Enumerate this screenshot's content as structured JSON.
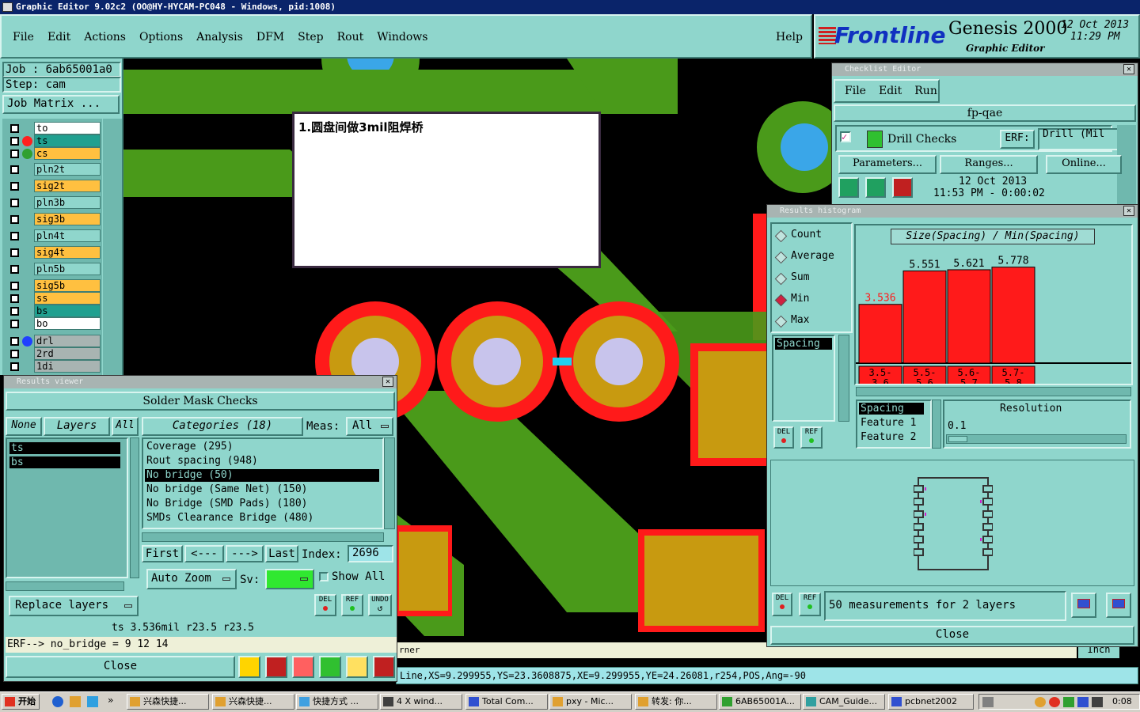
{
  "title_bar": {
    "text": "Graphic Editor 9.02c2  (OO@HY-HYCAM-PC048 - Windows, pid:1008)"
  },
  "menu": [
    "File",
    "Edit",
    "Actions",
    "Options",
    "Analysis",
    "DFM",
    "Step",
    "Rout",
    "Windows"
  ],
  "help_label": "Help",
  "brand": {
    "logo": "Frontline",
    "product": "Genesis 2000",
    "subtitle": "Graphic Editor",
    "date": "12 Oct 2013",
    "time": "11:29 PM"
  },
  "job_panel": {
    "job": "Job  :  6ab65001a0",
    "step": "Step:  cam",
    "matrix_button": "Job Matrix ..."
  },
  "layers": [
    {
      "name": "to",
      "color": "#ffffff",
      "dot": ""
    },
    {
      "name": "ts",
      "color": "#20a090",
      "dot": "#ff2020"
    },
    {
      "name": "cs",
      "color": "#ffc040",
      "dot": "#30a030"
    },
    {
      "name": "pln2t",
      "color": "#8fd6cc",
      "dot": ""
    },
    {
      "name": "sig2t",
      "color": "#ffc040",
      "dot": ""
    },
    {
      "name": "pln3b",
      "color": "#8fd6cc",
      "dot": ""
    },
    {
      "name": "sig3b",
      "color": "#ffc040",
      "dot": ""
    },
    {
      "name": "pln4t",
      "color": "#8fd6cc",
      "dot": ""
    },
    {
      "name": "sig4t",
      "color": "#ffc040",
      "dot": ""
    },
    {
      "name": "pln5b",
      "color": "#8fd6cc",
      "dot": ""
    },
    {
      "name": "sig5b",
      "color": "#ffc040",
      "dot": ""
    },
    {
      "name": "ss",
      "color": "#ffc040",
      "dot": ""
    },
    {
      "name": "bs",
      "color": "#20a090",
      "dot": ""
    },
    {
      "name": "bo",
      "color": "#ffffff",
      "dot": ""
    },
    {
      "name": "drl",
      "color": "#a8b4b2",
      "dot": "#2040ff"
    },
    {
      "name": "2rd",
      "color": "#a8b4b2",
      "dot": ""
    },
    {
      "name": "1di",
      "color": "#a8b4b2",
      "dot": ""
    }
  ],
  "note_popup": {
    "text": "1.圆盘间做3mil阻焊桥"
  },
  "results_viewer": {
    "title": "Results viewer",
    "header": "Solder Mask Checks",
    "none_btn": "None",
    "layers_btn": "Layers",
    "all_btn": "All",
    "layer_items": [
      "ts",
      "bs"
    ],
    "categories_label": "Categories (18)",
    "meas_label": "Meas:",
    "meas_value": "All",
    "categories": [
      "Coverage (295)",
      "Rout spacing (948)",
      "No bridge (50)",
      "No bridge (Same Net) (150)",
      "No Bridge (SMD Pads) (180)",
      "SMDs Clearance Bridge (480)"
    ],
    "selected_index": 2,
    "nav": {
      "first": "First",
      "prev": "<---",
      "next": "--->",
      "last": "Last",
      "index_label": "Index:",
      "index_value": "2696"
    },
    "auto_zoom": "Auto Zoom",
    "sv_label": "Sv:",
    "show_all": "Show All",
    "replace_layers": "Replace layers",
    "del": "DEL",
    "ref": "REF",
    "undo": "UNDO",
    "status1": "ts 3.536mil   r23.5   r23.5",
    "status2": "ERF--> no_bridge = 9 12 14",
    "close": "Close"
  },
  "checklist_editor": {
    "title": "Checklist Editor",
    "menu": [
      "File",
      "Edit",
      "Run"
    ],
    "name": "fp-qae",
    "check_name": "Drill Checks",
    "erf_label": "ERF:",
    "erf_value": "Drill (Mil",
    "buttons": [
      "Parameters...",
      "Ranges...",
      "Online..."
    ],
    "run_date": "12 Oct 2013",
    "run_time": "11:53 PM - 0:00:02"
  },
  "histogram": {
    "title": "Results histogram",
    "options": [
      {
        "label": "Count",
        "selected": false
      },
      {
        "label": "Average",
        "selected": false
      },
      {
        "label": "Sum",
        "selected": false
      },
      {
        "label": "Min",
        "selected": true
      },
      {
        "label": "Max",
        "selected": false
      }
    ],
    "list_items": [
      "Spacing"
    ],
    "chart_title": "Size(Spacing) / Min(Spacing)",
    "table_items": [
      "Spacing",
      "Feature 1",
      "Feature 2"
    ],
    "resolution_label": "Resolution",
    "resolution_value": "0.1",
    "measurements": "50 measurements for 2 layers",
    "del": "DEL",
    "ref": "REF",
    "close": "Close"
  },
  "chart_data": {
    "type": "bar",
    "title": "Size(Spacing) / Min(Spacing)",
    "categories": [
      "3.5-3.6",
      "5.5-5.6",
      "5.6-5.7",
      "5.7-5.8"
    ],
    "category_lines": [
      [
        "3.5-",
        "3.6"
      ],
      [
        "5.5-",
        "5.6"
      ],
      [
        "5.6-",
        "5.7"
      ],
      [
        "5.7-",
        "5.8"
      ]
    ],
    "values": [
      3.536,
      5.551,
      5.621,
      5.778
    ],
    "value_labels": [
      "3.536",
      "5.551",
      "5.621",
      "5.778"
    ],
    "ylim": [
      0,
      6.5
    ],
    "bar_color": "#ff1a1a",
    "first_label_color": "#ff1a1a",
    "grid": false
  },
  "status_lines": {
    "line1": "rner",
    "line2": "Line,XS=9.299955,YS=23.3608875,XE=9.299955,YE=24.26081,r254,POS,Ang=-90",
    "unit": "Inch"
  },
  "taskbar": {
    "start": "开始",
    "items": [
      "兴森快捷...",
      "兴森快捷...",
      "快捷方式 ...",
      "4 X wind...",
      "Total Com...",
      "pxy - Mic...",
      "转发: 你...",
      "6AB65001A...",
      "CAM_Guide...",
      "pcbnet2002"
    ],
    "clock": "0:08"
  }
}
